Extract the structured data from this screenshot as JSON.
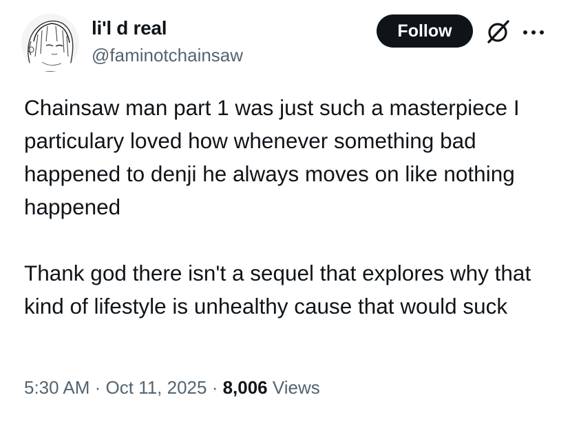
{
  "user": {
    "display_name": "li'l d real",
    "handle": "@faminotchainsaw",
    "avatar_icon": "manga-avatar"
  },
  "actions": {
    "follow_label": "Follow",
    "grok_icon": "grok-icon",
    "more_icon": "more-icon"
  },
  "post": {
    "paragraph_1": "Chainsaw man part 1 was just such a masterpiece I particulary loved how whenever something bad happened to denji he always moves on like nothing happened",
    "paragraph_2": "Thank god there isn't a sequel that explores why that kind of lifestyle is unhealthy cause that would suck"
  },
  "meta": {
    "time": "5:30 AM",
    "separator": " · ",
    "date": "Oct 11, 2025",
    "views_count": "8,006",
    "views_label": "Views"
  },
  "colors": {
    "text_primary": "#0f1419",
    "text_secondary": "#536471",
    "button_bg": "#0f1419",
    "button_text": "#ffffff"
  }
}
